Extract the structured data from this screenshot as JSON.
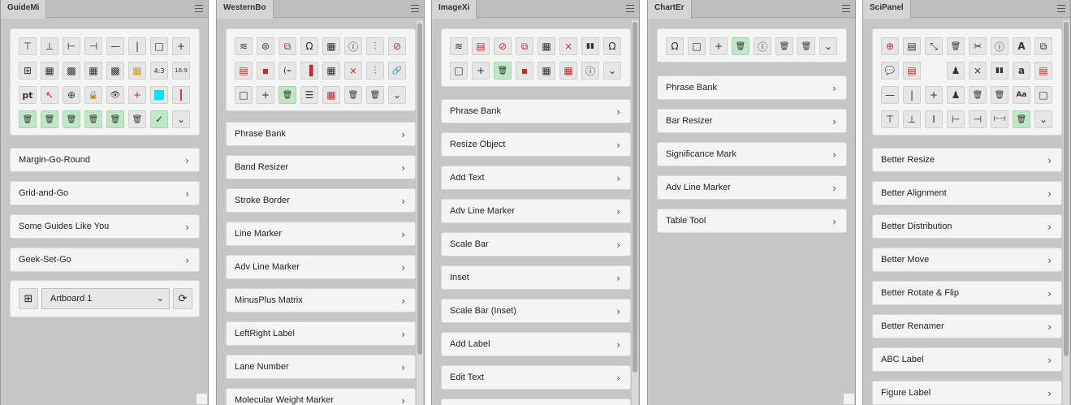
{
  "panels": [
    {
      "title": "GuideMi",
      "icons": [
        [
          "⊤",
          "⊥",
          "⊢",
          "⊣",
          "—",
          "|",
          "□",
          "+"
        ],
        [
          "⊞",
          "▦",
          "▩",
          "▦",
          "▩",
          "▦",
          "4:3",
          "16:9"
        ],
        [
          "pt",
          "↖",
          "⊕",
          "🔒",
          "👁",
          "+",
          "",
          ""
        ],
        [
          "🗑",
          "🗑",
          "🗑",
          "🗑",
          "🗑",
          "🗑",
          "✓",
          "⌄"
        ]
      ],
      "rows": [
        "Margin-Go-Round",
        "Grid-and-Go",
        "Some Guides Like You",
        "Geek-Set-Go"
      ],
      "artboard": "Artboard 1"
    },
    {
      "title": "WesternBo",
      "icons": [
        [
          "≋",
          "⊜",
          "⧉",
          "Ω",
          "▦",
          "ⓘ",
          "⫶",
          "⊘"
        ],
        [
          "▤",
          "▪",
          "(⌁",
          "▐",
          "▦",
          "⨯",
          "⫶",
          "🔗"
        ],
        [
          "□",
          "+",
          "🗑",
          "☰",
          "▦",
          "🗑",
          "🗑",
          "⌄"
        ]
      ],
      "rows": [
        "Phrase Bank",
        "Band Resizer",
        "Stroke Border",
        "Line Marker",
        "Adv Line Marker",
        "MinusPlus Matrix",
        "LeftRight Label",
        "Lane Number",
        "Molecular Weight Marker"
      ]
    },
    {
      "title": "ImageXi",
      "icons": [
        [
          "≋",
          "▤",
          "⊘",
          "⧉",
          "▦",
          "⨯",
          "▮▮",
          "Ω"
        ],
        [
          "□",
          "+",
          "🗑",
          "▪",
          "▦",
          "▦",
          "ⓘ",
          "⌄"
        ]
      ],
      "rows": [
        "Phrase Bank",
        "Resize Object",
        "Add Text",
        "Adv Line Marker",
        "Scale Bar",
        "Inset",
        "Scale Bar (Inset)",
        "Add Label",
        "Edit Text"
      ]
    },
    {
      "title": "ChartEr",
      "icons": [
        [
          "Ω",
          "□",
          "+",
          "🗑",
          "ⓘ",
          "🗑",
          "🗑",
          "⌄"
        ]
      ],
      "rows": [
        "Phrase Bank",
        "Bar Resizer",
        "Significance Mark",
        "Adv Line Marker",
        "Table Tool"
      ]
    },
    {
      "title": "SciPanel",
      "icons": [
        [
          "⊕",
          "▤",
          "⤡",
          "🗑",
          "✂",
          "ⓘ",
          "A",
          "⧉"
        ],
        [
          "💬",
          "▤",
          "",
          "♟",
          "⨯",
          "▮▮",
          "a",
          "▤"
        ],
        [
          "—",
          "|",
          "+",
          "♟",
          "🗑",
          "🗑",
          "Aa",
          "□"
        ],
        [
          "⊤",
          "⊥",
          "I",
          "⊢",
          "⊣",
          "⊢⊣",
          "🗑",
          "⌄"
        ]
      ],
      "rows": [
        "Better Resize",
        "Better Alignment",
        "Better Distribution",
        "Better Move",
        "Better Rotate & Flip",
        "Better Renamer",
        "ABC Label",
        "Figure Label"
      ]
    }
  ],
  "chevron": "›",
  "menu_icon": "hamburger-menu-icon",
  "colors": {
    "panel_bg": "#c6c6c6",
    "green_button": "#bfe7c6",
    "red_icon": "#c42b2b",
    "cyan_swatch": "#00e5ee"
  }
}
